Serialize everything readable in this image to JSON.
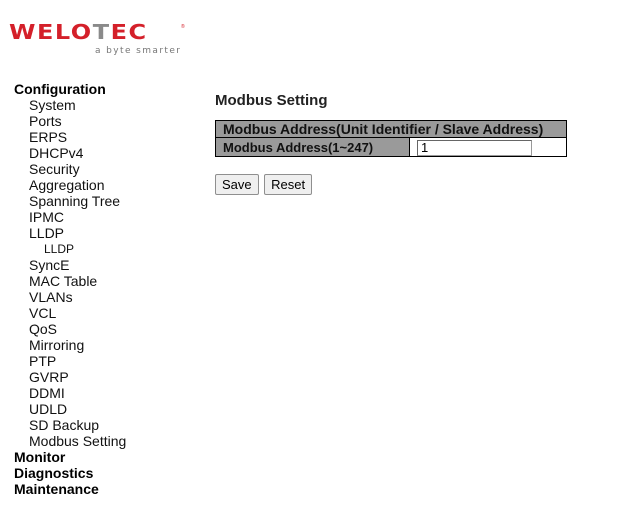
{
  "brand": {
    "logo_word_prefix": "WELO",
    "logo_word_t": "T",
    "logo_word_suffix": "EC",
    "logo_registered": "®",
    "tagline": "a byte smarter",
    "colors": {
      "primary_red": "#d4202a",
      "accent_grey": "#8a8a8a"
    }
  },
  "nav": {
    "groups": [
      {
        "label": "Configuration",
        "items": [
          {
            "label": "System"
          },
          {
            "label": "Ports"
          },
          {
            "label": "ERPS"
          },
          {
            "label": "DHCPv4"
          },
          {
            "label": "Security"
          },
          {
            "label": "Aggregation"
          },
          {
            "label": "Spanning Tree"
          },
          {
            "label": "IPMC"
          },
          {
            "label": "LLDP",
            "children": [
              {
                "label": "LLDP"
              }
            ]
          },
          {
            "label": "SyncE"
          },
          {
            "label": "MAC Table"
          },
          {
            "label": "VLANs"
          },
          {
            "label": "VCL"
          },
          {
            "label": "QoS"
          },
          {
            "label": "Mirroring"
          },
          {
            "label": "PTP"
          },
          {
            "label": "GVRP"
          },
          {
            "label": "DDMI"
          },
          {
            "label": "UDLD"
          },
          {
            "label": "SD Backup"
          },
          {
            "label": "Modbus Setting"
          }
        ]
      },
      {
        "label": "Monitor"
      },
      {
        "label": "Diagnostics"
      },
      {
        "label": "Maintenance"
      }
    ]
  },
  "main": {
    "title": "Modbus Setting",
    "table": {
      "header": "Modbus Address(Unit Identifier / Slave Address)",
      "rows": [
        {
          "label": "Modbus Address(1~247)",
          "value": "1"
        }
      ],
      "header_bg": "#9a9a9a"
    },
    "buttons": {
      "save_label": "Save",
      "reset_label": "Reset"
    }
  }
}
